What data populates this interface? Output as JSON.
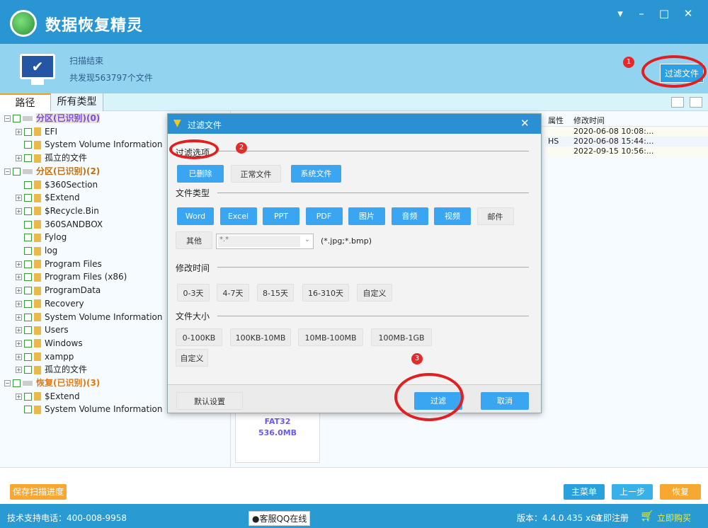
{
  "app": {
    "title": "数据恢复精灵",
    "window_controls": [
      "▾",
      "–",
      "□",
      "✕"
    ]
  },
  "header": {
    "status": "扫描结束",
    "found": "共发现563797个文件",
    "filter_button": "过滤文件"
  },
  "tabs": [
    "路径",
    "所有类型"
  ],
  "tree": [
    {
      "label": "分区(已识别)(0)",
      "level": 0,
      "color": "#7a4de0",
      "expand": "−"
    },
    {
      "label": "EFI",
      "level": 1,
      "expand": "+"
    },
    {
      "label": "System Volume Information",
      "level": 1,
      "expand": ""
    },
    {
      "label": "孤立的文件",
      "level": 1,
      "expand": "+"
    },
    {
      "label": "分区(已识别)(2)",
      "level": 0,
      "color": "#c07010",
      "expand": "−"
    },
    {
      "label": "$360Section",
      "level": 1,
      "expand": ""
    },
    {
      "label": "$Extend",
      "level": 1,
      "expand": "+"
    },
    {
      "label": "$Recycle.Bin",
      "level": 1,
      "expand": "+"
    },
    {
      "label": "360SANDBOX",
      "level": 1,
      "expand": ""
    },
    {
      "label": "Fylog",
      "level": 1,
      "expand": ""
    },
    {
      "label": "log",
      "level": 1,
      "expand": ""
    },
    {
      "label": "Program Files",
      "level": 1,
      "expand": "+"
    },
    {
      "label": "Program Files (x86)",
      "level": 1,
      "expand": "+"
    },
    {
      "label": "ProgramData",
      "level": 1,
      "expand": "+"
    },
    {
      "label": "Recovery",
      "level": 1,
      "expand": "+"
    },
    {
      "label": "System Volume Information",
      "level": 1,
      "expand": "+"
    },
    {
      "label": "Users",
      "level": 1,
      "expand": "+"
    },
    {
      "label": "Windows",
      "level": 1,
      "expand": "+"
    },
    {
      "label": "xampp",
      "level": 1,
      "expand": "+"
    },
    {
      "label": "孤立的文件",
      "level": 1,
      "expand": "+"
    },
    {
      "label": "恢复(已识别)(3)",
      "level": 0,
      "color": "#e07a10",
      "expand": "−"
    },
    {
      "label": "$Extend",
      "level": 1,
      "expand": "+"
    },
    {
      "label": "System Volume Information",
      "level": 1,
      "expand": ""
    }
  ],
  "list": {
    "columns": [
      "属性",
      "修改时间"
    ],
    "rows": [
      {
        "attr": "",
        "time": "2020-06-08 10:08:..."
      },
      {
        "attr": "HS",
        "time": "2020-06-08 15:44:..."
      },
      {
        "attr": "",
        "time": "2022-09-15 10:56:..."
      }
    ]
  },
  "card": {
    "fs": "FAT32",
    "size": "536.0MB"
  },
  "dialog": {
    "title": "过滤文件",
    "options_label": "过滤选项",
    "options": [
      {
        "label": "已删除",
        "on": true
      },
      {
        "label": "正常文件",
        "on": false
      },
      {
        "label": "系统文件",
        "on": true
      }
    ],
    "type_label": "文件类型",
    "types": [
      {
        "label": "Word",
        "on": true
      },
      {
        "label": "Excel",
        "on": true
      },
      {
        "label": "PPT",
        "on": true
      },
      {
        "label": "PDF",
        "on": true
      },
      {
        "label": "图片",
        "on": true
      },
      {
        "label": "音频",
        "on": true
      },
      {
        "label": "视频",
        "on": true
      },
      {
        "label": "邮件",
        "on": false
      }
    ],
    "other_label": "其他",
    "other_value": "*.*",
    "other_hint": "(*.jpg;*.bmp)",
    "time_label": "修改时间",
    "times": [
      "0-3天",
      "4-7天",
      "8-15天",
      "16-310天",
      "自定义"
    ],
    "size_label": "文件大小",
    "sizes": [
      "0-100KB",
      "100KB-10MB",
      "10MB-100MB",
      "100MB-1GB"
    ],
    "size_custom": "自定义",
    "default_button": "默认设置",
    "filter_button": "过滤",
    "cancel_button": "取消"
  },
  "annotations": [
    "1",
    "2",
    "3"
  ],
  "bottom": {
    "save": "保存扫描进度",
    "main_menu": "主菜单",
    "back": "上一步",
    "recover": "恢复"
  },
  "footer": {
    "phone": "技术支持电话：400-008-9958",
    "qq": "客服QQ在线",
    "version": "版本：4.4.0.435 x64",
    "register": "立即注册",
    "buy": "立即购买"
  },
  "colors": {
    "accent": "#2a95d3",
    "button_on": "#3aa6f2",
    "orange": "#f7a830",
    "annotation": "#e02020"
  }
}
